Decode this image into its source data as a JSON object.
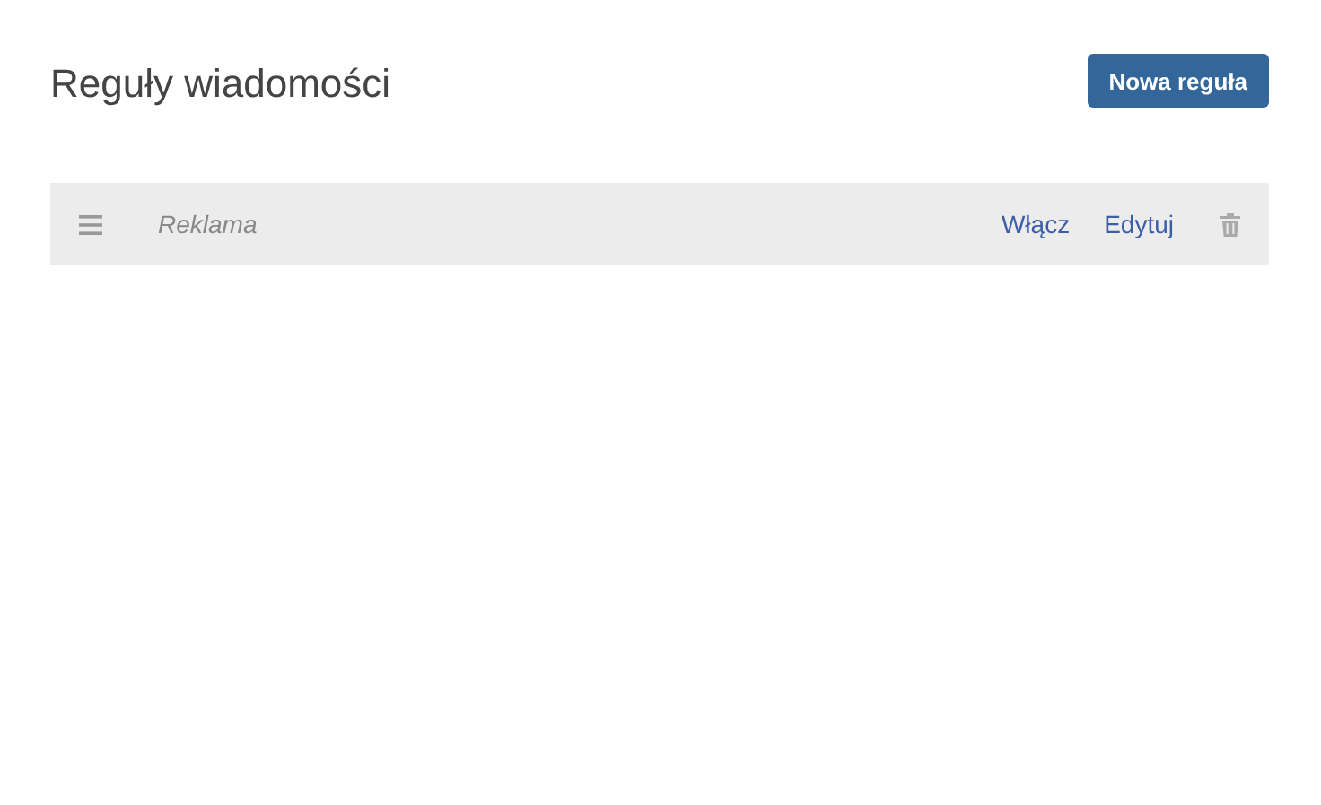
{
  "title": "Reguły wiadomości",
  "new_button": "Nowa reguła",
  "rules": [
    {
      "name": "Reklama",
      "enabled": false,
      "toggle": "Włącz",
      "edit": "Edytuj"
    }
  ]
}
